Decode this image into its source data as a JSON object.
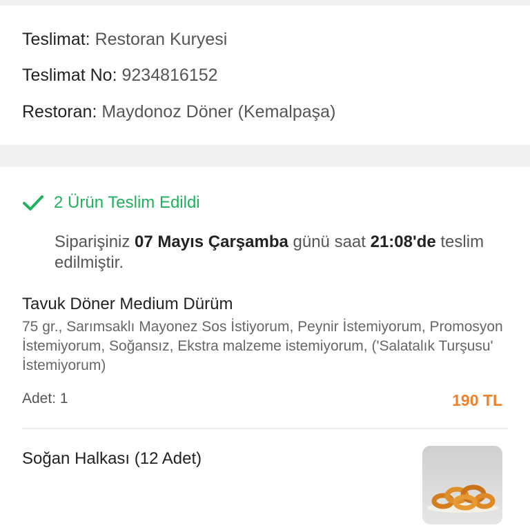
{
  "delivery_info": {
    "type_label": "Teslimat:",
    "type_value": "Restoran Kuryesi",
    "no_label": "Teslimat No:",
    "no_value": "9234816152",
    "restaurant_label": "Restoran:",
    "restaurant_value": "Maydonoz Döner (Kemalpaşa)"
  },
  "status": {
    "icon": "check-icon",
    "text": "2 Ürün Teslim Edildi",
    "color": "#1fb15b",
    "message_prefix": "Siparişiniz",
    "message_date": "07 Mayıs Çarşamba",
    "message_mid": "günü saat",
    "message_time": "21:08'de",
    "message_suffix": "teslim edilmiştir."
  },
  "items": [
    {
      "name": "Tavuk Döner Medium Dürüm",
      "description": "75 gr., Sarımsaklı Mayonez Sos İstiyorum, Peynir İstemiyorum, Promosyon İstemiyorum, Soğansız, Ekstra malzeme istemiyorum, ('Salatalık Turşusu' İstemiyorum)",
      "qty_label": "Adet: 1",
      "price": "190 TL",
      "price_color": "#f0812a"
    },
    {
      "name": "Soğan Halkası (12 Adet)",
      "image": "onion-rings-photo"
    }
  ]
}
